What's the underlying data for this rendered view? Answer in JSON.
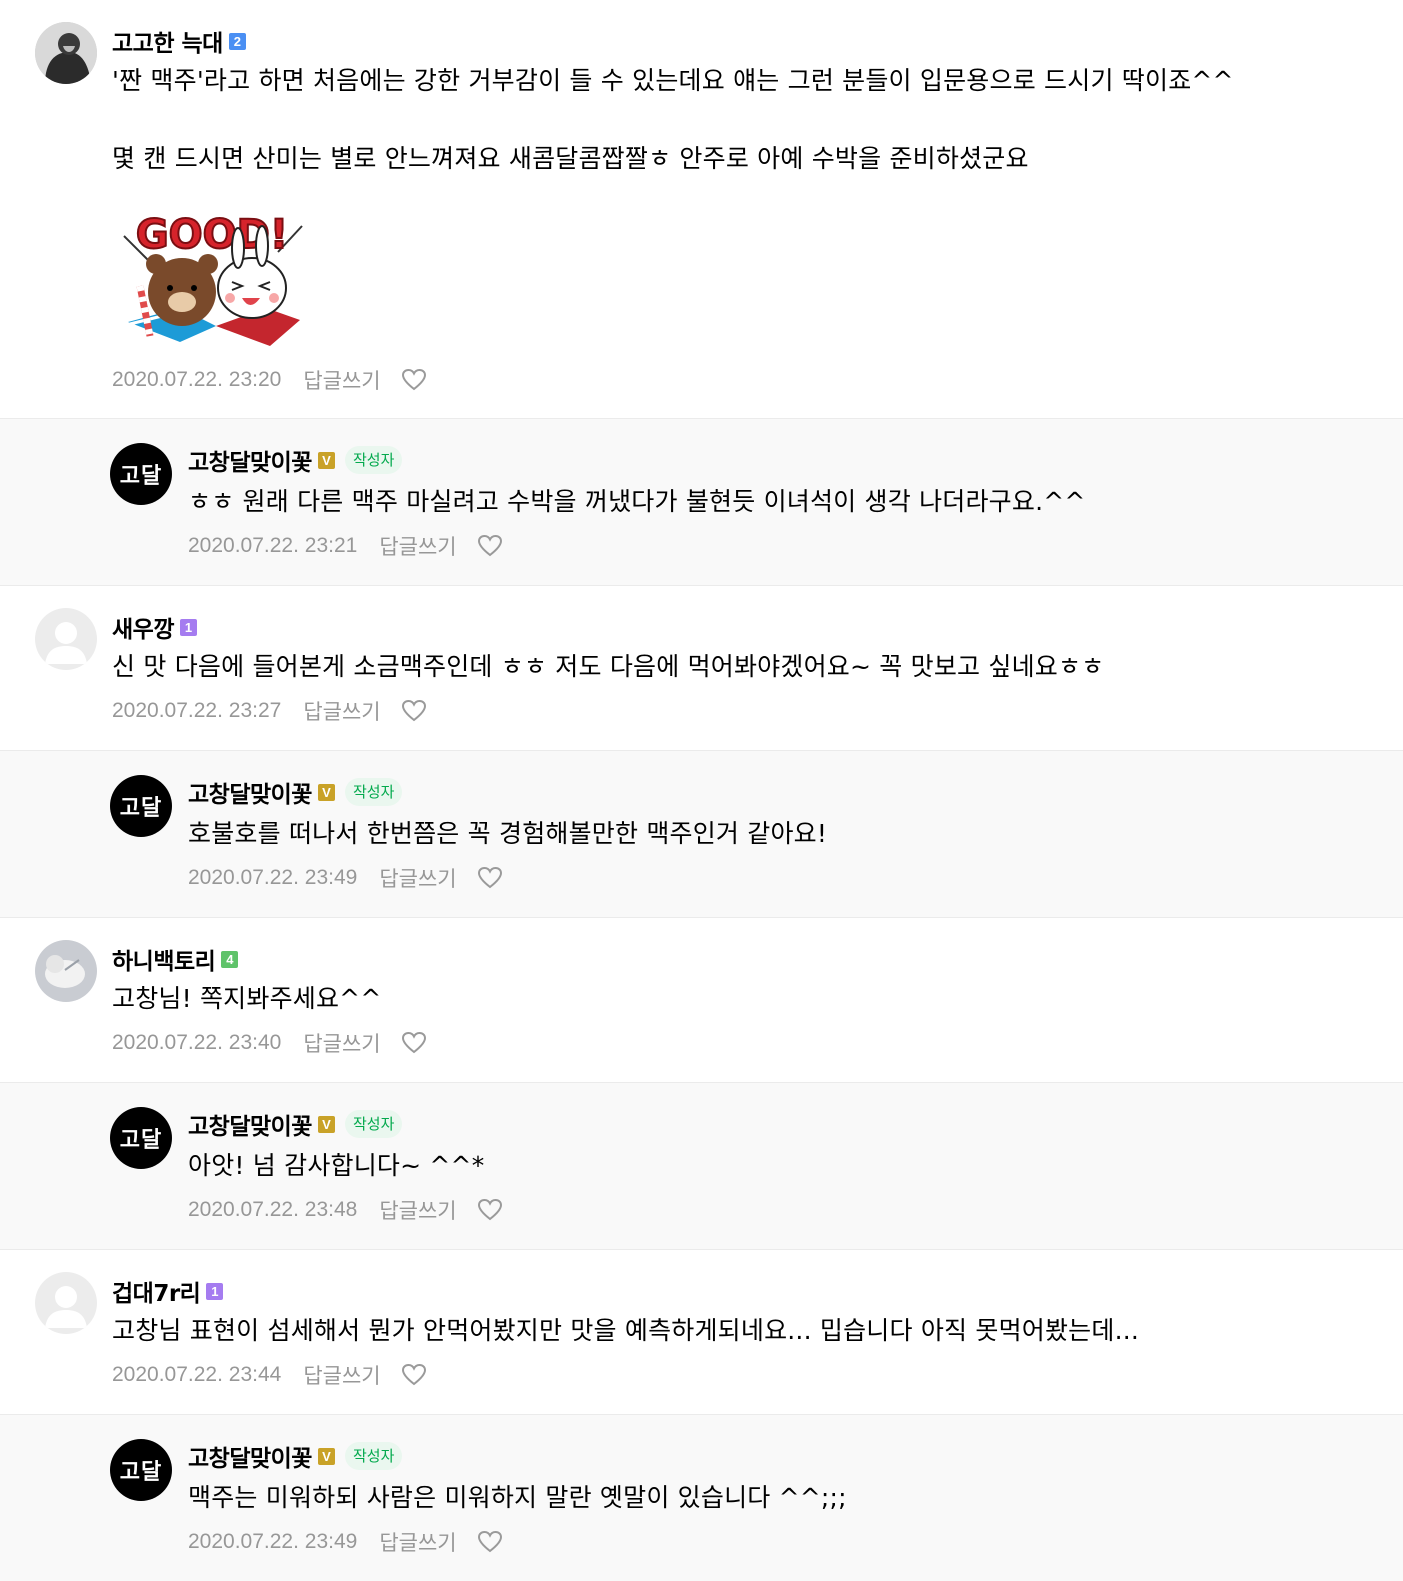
{
  "comments": [
    {
      "nick": "고고한 늑대",
      "level": "2",
      "level_color": "#4a8ff3",
      "lines": [
        "'짠 맥주'라고 하면 처음에는 강한 거부감이 들 수 있는데요 얘는 그런 분들이 입문용으로 드시기 딱이죠^^",
        "몇 캔 드시면 산미는 별로 안느껴져요 새콤달콤짭짤ㅎ 안주로 아예 수박을 준비하셨군요"
      ],
      "sticker_text": "GOOD!",
      "date": "2020.07.22. 23:20",
      "reply_label": "답글쓰기"
    },
    {
      "nick": "고창달맞이꽃",
      "level": "V",
      "level_color": "#c9a228",
      "author_badge": "작성자",
      "avatar_text": "고달",
      "text": "ㅎㅎ 원래 다른 맥주 마실려고 수박을 꺼냈다가 불현듯 이녀석이 생각 나더라구요.^^",
      "date": "2020.07.22. 23:21",
      "reply_label": "답글쓰기"
    },
    {
      "nick": "새우깡",
      "level": "1",
      "level_color": "#a57cf0",
      "text": "신 맛 다음에 들어본게 소금맥주인데 ㅎㅎ 저도 다음에 먹어봐야겠어요~ 꼭 맛보고 싶네요ㅎㅎ",
      "date": "2020.07.22. 23:27",
      "reply_label": "답글쓰기"
    },
    {
      "nick": "고창달맞이꽃",
      "level": "V",
      "level_color": "#c9a228",
      "author_badge": "작성자",
      "avatar_text": "고달",
      "text": "호불호를 떠나서 한번쯤은 꼭 경험해볼만한 맥주인거 같아요!",
      "date": "2020.07.22. 23:49",
      "reply_label": "답글쓰기"
    },
    {
      "nick": "하니백토리",
      "level": "4",
      "level_color": "#5fc36a",
      "text": "고창님! 쪽지봐주세요^^",
      "date": "2020.07.22. 23:40",
      "reply_label": "답글쓰기"
    },
    {
      "nick": "고창달맞이꽃",
      "level": "V",
      "level_color": "#c9a228",
      "author_badge": "작성자",
      "avatar_text": "고달",
      "text": "아앗! 넘 감사합니다~ ^^*",
      "date": "2020.07.22. 23:48",
      "reply_label": "답글쓰기"
    },
    {
      "nick": "겁대7r리",
      "level": "1",
      "level_color": "#a57cf0",
      "text": "고창님 표현이 섬세해서 뭔가 안먹어봤지만 맛을 예측하게되네요... 밉습니다 아직 못먹어봤는데...",
      "date": "2020.07.22. 23:44",
      "reply_label": "답글쓰기"
    },
    {
      "nick": "고창달맞이꽃",
      "level": "V",
      "level_color": "#c9a228",
      "author_badge": "작성자",
      "avatar_text": "고달",
      "text": "맥주는 미워하되 사람은 미워하지 말란 옛말이 있습니다 ^^;;;",
      "date": "2020.07.22. 23:49",
      "reply_label": "답글쓰기"
    }
  ]
}
